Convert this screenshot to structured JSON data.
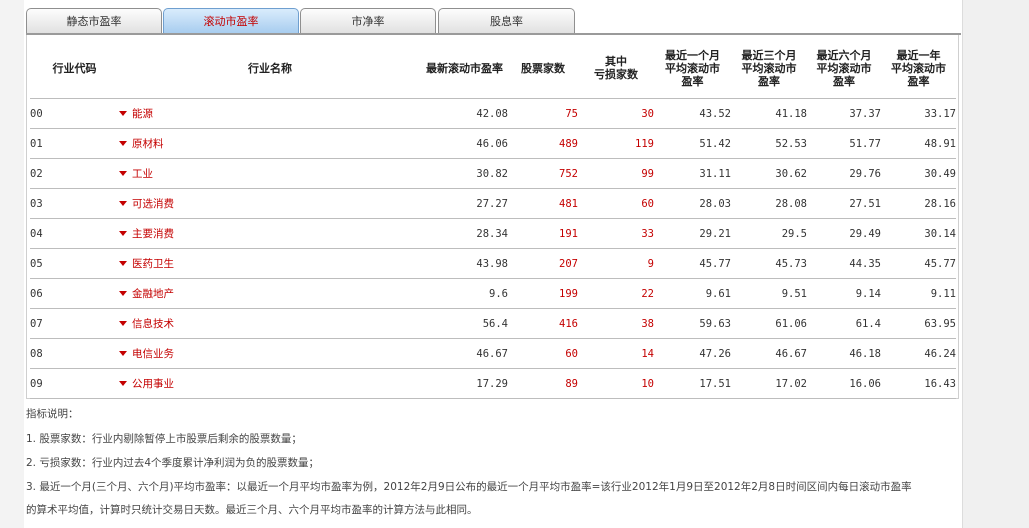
{
  "tabs": [
    {
      "label": "静态市盈率",
      "active": false
    },
    {
      "label": "滚动市盈率",
      "active": true
    },
    {
      "label": "市净率",
      "active": false
    },
    {
      "label": "股息率",
      "active": false
    }
  ],
  "table": {
    "headers": {
      "code": "行业代码",
      "name": "行业名称",
      "pe": "最新滚动市盈率",
      "count": "股票家数",
      "loss": [
        "其中",
        "亏损家数"
      ],
      "m1": [
        "最近一个月",
        "平均滚动市",
        "盈率"
      ],
      "m3": [
        "最近三个月",
        "平均滚动市",
        "盈率"
      ],
      "m6": [
        "最近六个月",
        "平均滚动市",
        "盈率"
      ],
      "y1": [
        "最近一年",
        "平均滚动市",
        "盈率"
      ]
    },
    "rows": [
      {
        "code": "00",
        "name": "能源",
        "pe": "42.08",
        "count": "75",
        "loss": "30",
        "m1": "43.52",
        "m3": "41.18",
        "m6": "37.37",
        "y1": "33.17"
      },
      {
        "code": "01",
        "name": "原材料",
        "pe": "46.06",
        "count": "489",
        "loss": "119",
        "m1": "51.42",
        "m3": "52.53",
        "m6": "51.77",
        "y1": "48.91"
      },
      {
        "code": "02",
        "name": "工业",
        "pe": "30.82",
        "count": "752",
        "loss": "99",
        "m1": "31.11",
        "m3": "30.62",
        "m6": "29.76",
        "y1": "30.49"
      },
      {
        "code": "03",
        "name": "可选消费",
        "pe": "27.27",
        "count": "481",
        "loss": "60",
        "m1": "28.03",
        "m3": "28.08",
        "m6": "27.51",
        "y1": "28.16"
      },
      {
        "code": "04",
        "name": "主要消费",
        "pe": "28.34",
        "count": "191",
        "loss": "33",
        "m1": "29.21",
        "m3": "29.5",
        "m6": "29.49",
        "y1": "30.14"
      },
      {
        "code": "05",
        "name": "医药卫生",
        "pe": "43.98",
        "count": "207",
        "loss": "9",
        "m1": "45.77",
        "m3": "45.73",
        "m6": "44.35",
        "y1": "45.77"
      },
      {
        "code": "06",
        "name": "金融地产",
        "pe": "9.6",
        "count": "199",
        "loss": "22",
        "m1": "9.61",
        "m3": "9.51",
        "m6": "9.14",
        "y1": "9.11"
      },
      {
        "code": "07",
        "name": "信息技术",
        "pe": "56.4",
        "count": "416",
        "loss": "38",
        "m1": "59.63",
        "m3": "61.06",
        "m6": "61.4",
        "y1": "63.95"
      },
      {
        "code": "08",
        "name": "电信业务",
        "pe": "46.67",
        "count": "60",
        "loss": "14",
        "m1": "47.26",
        "m3": "46.67",
        "m6": "46.18",
        "y1": "46.24"
      },
      {
        "code": "09",
        "name": "公用事业",
        "pe": "17.29",
        "count": "89",
        "loss": "10",
        "m1": "17.51",
        "m3": "17.02",
        "m6": "16.06",
        "y1": "16.43"
      }
    ]
  },
  "notes": {
    "title": "指标说明：",
    "items": [
      "1. 股票家数：行业内剔除暂停上市股票后剩余的股票数量；",
      "2. 亏损家数：行业内过去4个季度累计净利润为负的股票数量；",
      "3. 最近一个月(三个月、六个月)平均市盈率：以最近一个月平均市盈率为例，2012年2月9日公布的最近一个月平均市盈率=该行业2012年1月9日至2012年2月8日时间区间内每日滚动市盈率",
      "的算术平均值，计算时只统计交易日天数。最近三个月、六个月平均市盈率的计算方法与此相同。"
    ]
  },
  "colors": {
    "accent": "#c40000",
    "active_tab": "#a8cdef"
  }
}
